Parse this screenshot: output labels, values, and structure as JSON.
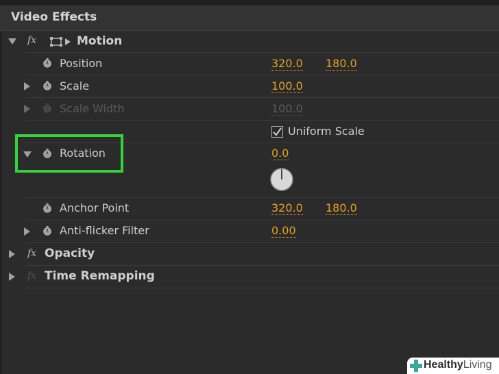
{
  "header": {
    "title": "Video Effects"
  },
  "motion": {
    "fx": "fx",
    "label": "Motion"
  },
  "position": {
    "label": "Position",
    "x": "320.0",
    "y": "180.0"
  },
  "scale": {
    "label": "Scale",
    "value": "100.0"
  },
  "scale_width": {
    "label": "Scale Width",
    "value": "100.0"
  },
  "uniform_scale": {
    "label": "Uniform Scale",
    "checked": true
  },
  "rotation": {
    "label": "Rotation",
    "value": "0.0"
  },
  "anchor_point": {
    "label": "Anchor Point",
    "x": "320.0",
    "y": "180.0"
  },
  "anti_flicker": {
    "label": "Anti-flicker Filter",
    "value": "0.00"
  },
  "opacity": {
    "fx": "fx",
    "label": "Opacity"
  },
  "time_remapping": {
    "fx": "fx",
    "label": "Time Remapping"
  },
  "watermark": {
    "bold": "Healthy",
    "light": "Living"
  },
  "colors": {
    "highlight": "#35d33a",
    "value": "#e6a21e",
    "background": "#2b2b2b"
  }
}
